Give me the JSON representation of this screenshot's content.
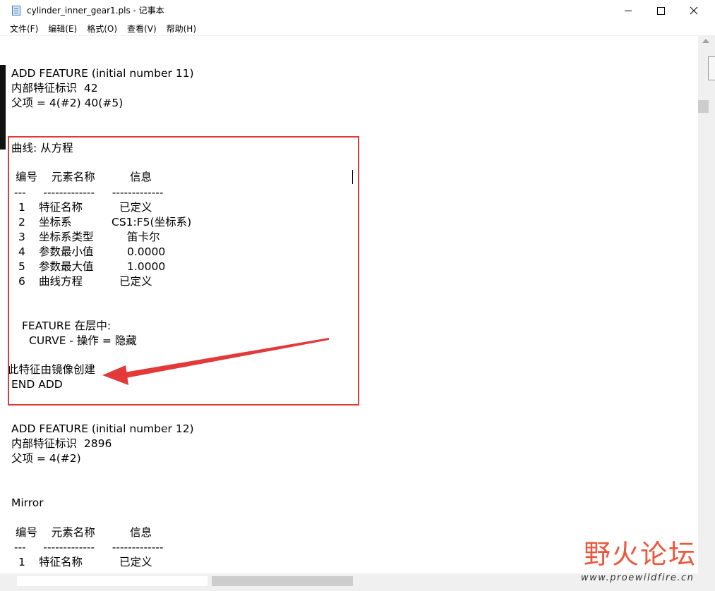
{
  "window": {
    "title": "cylinder_inner_gear1.pls - 记事本"
  },
  "menu": [
    "文件(F)",
    "编辑(E)",
    "格式(O)",
    "查看(V)",
    "帮助(H)"
  ],
  "document": {
    "lines": [
      "ADD FEATURE (initial number 11)",
      "内部特征标识  42",
      "父项 = 4(#2) 40(#5)",
      "曲线: 从方程",
      "编号    元素名称          信息",
      "---     -------------     -------------",
      "1",
      "特征名称",
      "已定义",
      "2",
      "坐标系",
      "CS1:F5(坐标系)",
      "3",
      "坐标系类型",
      "笛卡尔",
      "4",
      "参数最小值",
      "0.0000",
      "5",
      "参数最大值",
      "1.0000",
      "6",
      "曲线方程",
      "已定义",
      "FEATURE 在层中:",
      "CURVE - 操作 = 隐藏",
      "此特征由镜像创建",
      "END ADD",
      "ADD FEATURE (initial number 12)",
      "内部特征标识  2896",
      "父项 = 4(#2)",
      "Mirror",
      "编号    元素名称          信息",
      "---     -------------     -------------",
      "1",
      "特征名称",
      "已定义"
    ]
  },
  "watermark": {
    "logo_text": "野火论坛",
    "url": "www.proewildfire.cn"
  },
  "colors": {
    "highlight": "#e23a3a",
    "watermark": "#e9472a"
  }
}
